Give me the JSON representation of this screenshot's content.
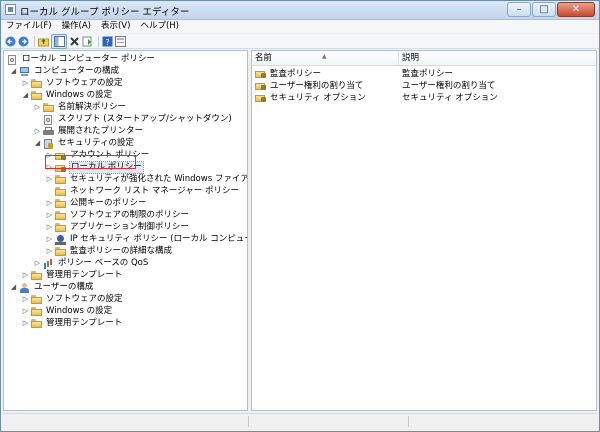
{
  "window": {
    "title": "ローカル グループ ポリシー エディター"
  },
  "menu": [
    "ファイル(F)",
    "操作(A)",
    "表示(V)",
    "ヘルプ(H)"
  ],
  "toolbar": [
    "back-icon",
    "forward-icon",
    "up-folder-icon",
    "show-hide-tree-icon",
    "delete-icon",
    "refresh-icon",
    "help-icon",
    "properties-icon"
  ],
  "tree": [
    {
      "label": "ローカル コンピューター ポリシー",
      "icon": "policy-icon"
    },
    {
      "label": "コンピューターの構成",
      "icon": "computer-icon"
    },
    {
      "label": "ソフトウェアの設定",
      "icon": "folder-icon"
    },
    {
      "label": "Windows の設定",
      "icon": "folder-icon"
    },
    {
      "label": "名前解決ポリシー",
      "icon": "folder-icon"
    },
    {
      "label": "スクリプト (スタートアップ/シャットダウン)",
      "icon": "script-icon"
    },
    {
      "label": "展開されたプリンター",
      "icon": "printer-icon"
    },
    {
      "label": "セキュリティの設定",
      "icon": "security-settings-icon"
    },
    {
      "label": "アカウント ポリシー",
      "icon": "folder-icon"
    },
    {
      "label": "ローカル ポリシー",
      "icon": "folder-icon"
    },
    {
      "label": "セキュリティが強化された Windows ファイアウォール",
      "icon": "folder-icon"
    },
    {
      "label": "ネットワーク リスト マネージャー ポリシー",
      "icon": "folder-icon"
    },
    {
      "label": "公開キーのポリシー",
      "icon": "folder-icon"
    },
    {
      "label": "ソフトウェアの制限のポリシー",
      "icon": "folder-icon"
    },
    {
      "label": "アプリケーション制御ポリシー",
      "icon": "folder-icon"
    },
    {
      "label": "IP セキュリティ ポリシー (ローカル コンピューター)",
      "icon": "ip-security-icon"
    },
    {
      "label": "監査ポリシーの詳細な構成",
      "icon": "folder-icon"
    },
    {
      "label": "ポリシー ベースの QoS",
      "icon": "qos-chart-icon"
    },
    {
      "label": "管理用テンプレート",
      "icon": "folder-icon"
    },
    {
      "label": "ユーザーの構成",
      "icon": "user-icon"
    },
    {
      "label": "ソフトウェアの設定",
      "icon": "folder-icon"
    },
    {
      "label": "Windows の設定",
      "icon": "folder-icon"
    },
    {
      "label": "管理用テンプレート",
      "icon": "folder-icon"
    }
  ],
  "list": {
    "columns": {
      "name": "名前",
      "description": "説明"
    },
    "rows": [
      {
        "name": "監査ポリシー",
        "description": "監査ポリシー"
      },
      {
        "name": "ユーザー権利の割り当て",
        "description": "ユーザー権利の割り当て"
      },
      {
        "name": "セキュリティ オプション",
        "description": "セキュリティ オプション"
      }
    ]
  },
  "colors": {
    "highlight": "#e0302a",
    "selection": "#dfeaf6"
  }
}
